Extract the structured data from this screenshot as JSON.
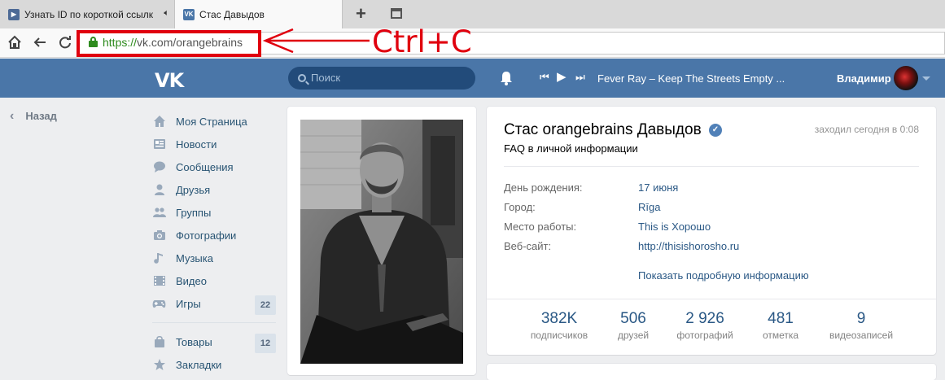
{
  "browser": {
    "tabs": [
      {
        "title": "Узнать ID по короткой ссылк",
        "active": false,
        "audio": true
      },
      {
        "title": "Стас Давыдов",
        "active": true
      }
    ],
    "url": {
      "protocol": "https://",
      "host": "vk.com/orangebrains"
    }
  },
  "annotation": {
    "text": "Ctrl+C",
    "color": "#e0000e"
  },
  "vk_header": {
    "search_placeholder": "Поиск",
    "track": "Fever Ray – Keep The Streets Empty ...",
    "user_name": "Владимир"
  },
  "left_nav": {
    "back_label": "Назад",
    "items": [
      {
        "label": "Моя Страница",
        "icon": "home-icon"
      },
      {
        "label": "Новости",
        "icon": "news-icon"
      },
      {
        "label": "Сообщения",
        "icon": "messages-icon"
      },
      {
        "label": "Друзья",
        "icon": "friends-icon"
      },
      {
        "label": "Группы",
        "icon": "groups-icon"
      },
      {
        "label": "Фотографии",
        "icon": "camera-icon"
      },
      {
        "label": "Музыка",
        "icon": "music-icon"
      },
      {
        "label": "Видео",
        "icon": "video-icon"
      },
      {
        "label": "Игры",
        "icon": "gamepad-icon",
        "count": "22"
      }
    ],
    "items2": [
      {
        "label": "Товары",
        "icon": "shopping-bag-icon",
        "count": "12"
      },
      {
        "label": "Закладки",
        "icon": "star-icon"
      }
    ]
  },
  "profile": {
    "name": "Стас orangebrains Давыдов",
    "last_seen": "заходил сегодня в 0:08",
    "status": "FAQ в личной информации",
    "info": [
      {
        "label": "День рождения:",
        "value": "17 июня"
      },
      {
        "label": "Город:",
        "value": "Rīga"
      },
      {
        "label": "Место работы:",
        "value": "This is Хорошо"
      },
      {
        "label": "Веб-сайт:",
        "value": "http://thisishorosho.ru"
      }
    ],
    "show_more": "Показать подробную информацию",
    "counters": [
      {
        "num": "382K",
        "label": "подписчиков"
      },
      {
        "num": "506",
        "label": "друзей"
      },
      {
        "num": "2 926",
        "label": "фотографий"
      },
      {
        "num": "481",
        "label": "отметка"
      },
      {
        "num": "9",
        "label": "видеозаписей"
      }
    ]
  },
  "colors": {
    "vk_blue": "#4a76a8",
    "link": "#2a5885",
    "annotation_red": "#e0000e"
  }
}
